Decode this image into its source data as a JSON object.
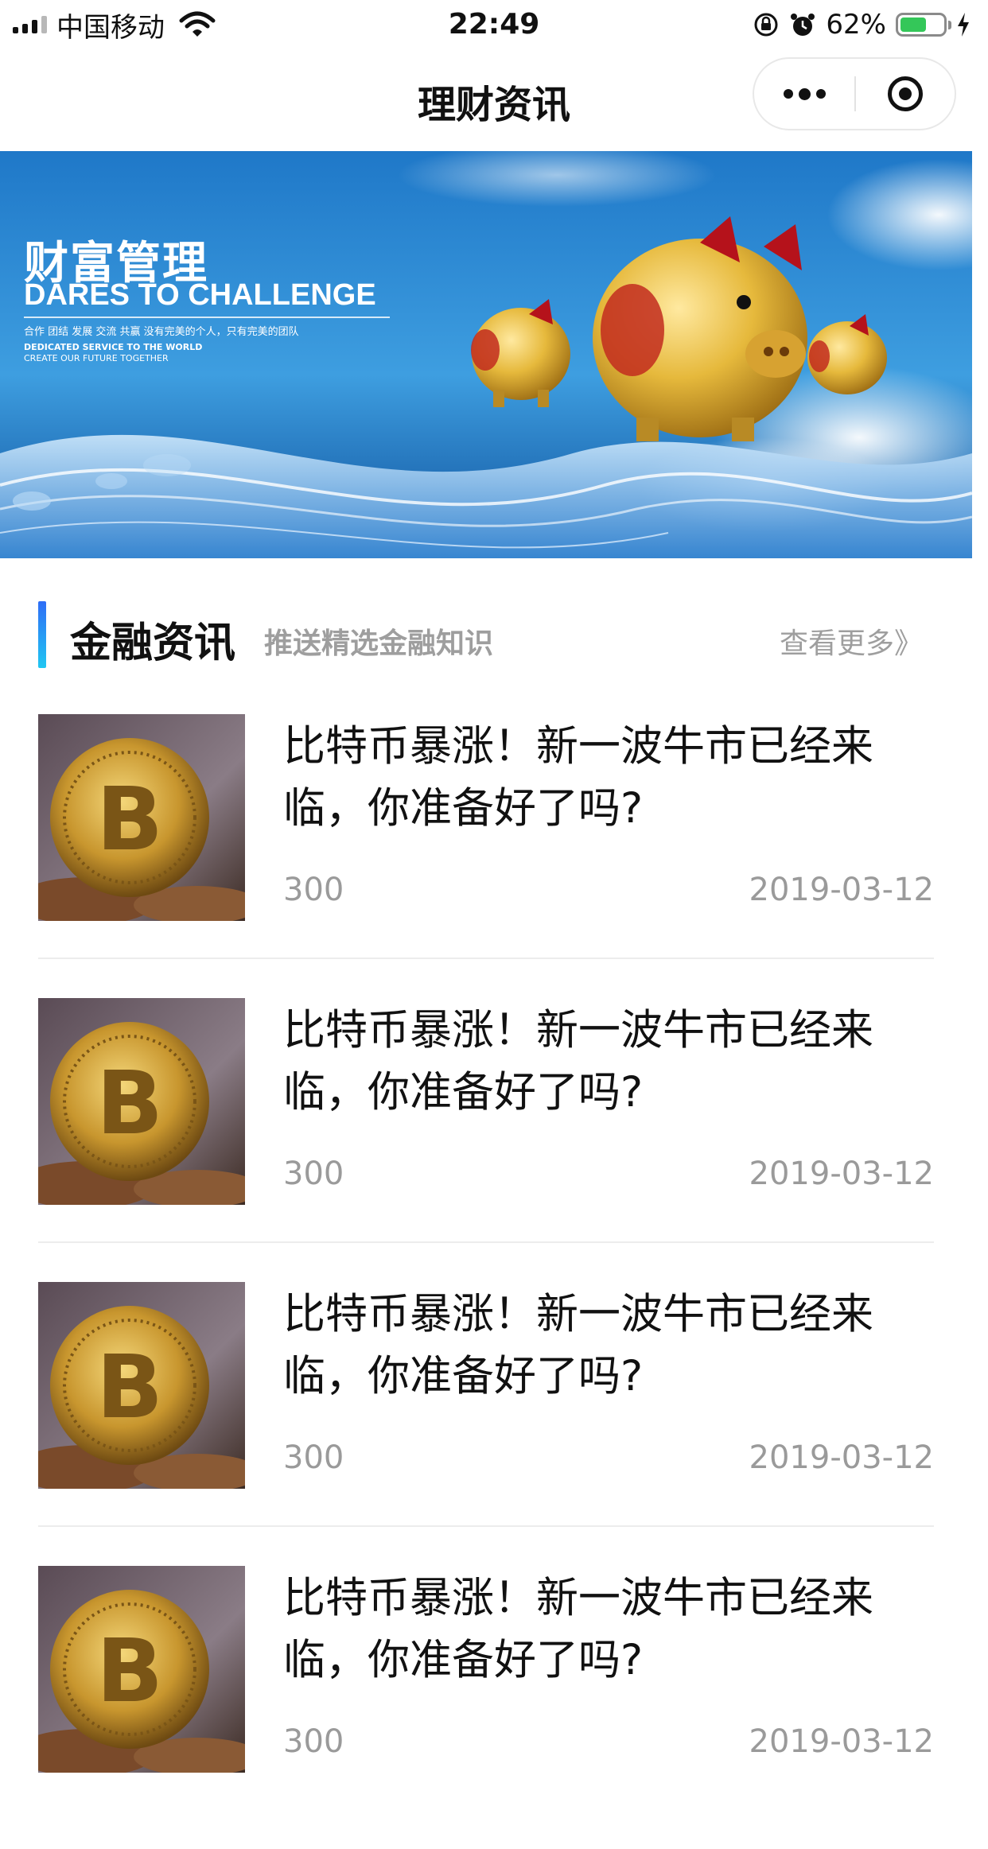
{
  "status_bar": {
    "carrier": "中国移动",
    "time": "22:49",
    "battery_percent": "62%",
    "battery_level": 0.62,
    "icons": [
      "signal-icon",
      "wifi-icon",
      "orientation-lock-icon",
      "alarm-icon",
      "battery-icon",
      "charging-icon"
    ]
  },
  "nav": {
    "title": "理财资讯",
    "menu_icon": "more-dots-icon",
    "close_icon": "mini-program-close-icon"
  },
  "banner": {
    "title": "财富管理",
    "subtitle": "DARES TO CHALLENGE",
    "line1": "合作  团结  发展  交流  共赢      没有完美的个人，只有完美的团队",
    "line2": "DEDICATED SERVICE TO THE WORLD",
    "line3": "CREATE OUR FUTURE TOGETHER"
  },
  "section": {
    "title": "金融资讯",
    "subtitle": "推送精选金融知识",
    "more": "查看更多》"
  },
  "news": [
    {
      "title": "比特币暴涨！新一波牛市已经来临，你准备好了吗?",
      "count": "300",
      "date": "2019-03-12"
    },
    {
      "title": "比特币暴涨！新一波牛市已经来临，你准备好了吗?",
      "count": "300",
      "date": "2019-03-12"
    },
    {
      "title": "比特币暴涨！新一波牛市已经来临，你准备好了吗?",
      "count": "300",
      "date": "2019-03-12"
    },
    {
      "title": "比特币暴涨！新一波牛市已经来临，你准备好了吗?",
      "count": "300",
      "date": "2019-03-12"
    }
  ],
  "colors": {
    "accent_top": "#2f6df6",
    "accent_bottom": "#20c7f2",
    "battery_green": "#34c759",
    "muted_text": "#9a9a9a"
  }
}
